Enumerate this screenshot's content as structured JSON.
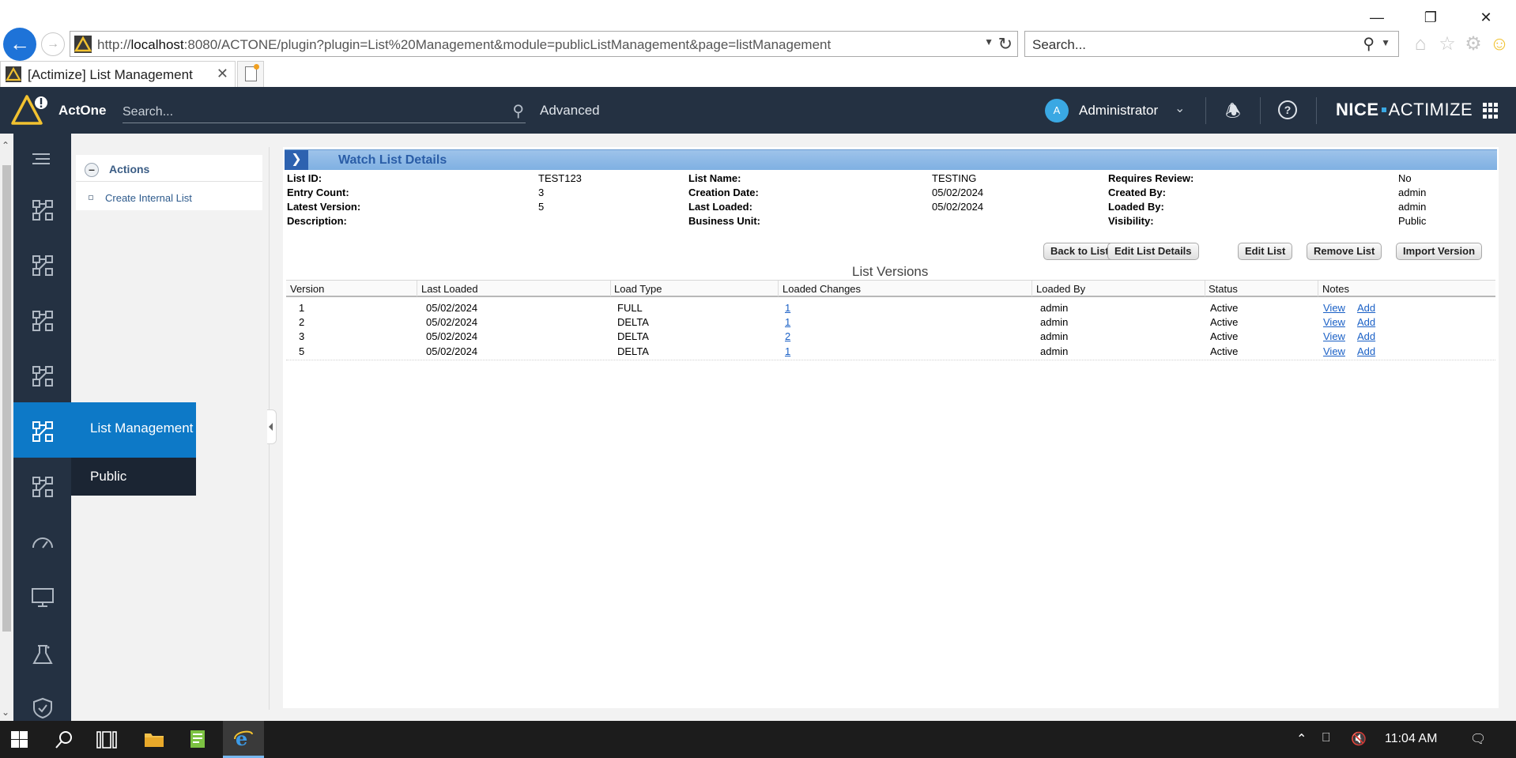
{
  "browser": {
    "url_prefix": "http://",
    "url_host": "localhost",
    "url_rest": ":8080/ACTONE/plugin?plugin=List%20Management&module=publicListManagement&page=listManagement",
    "search_placeholder": "Search...",
    "tab_title": "[Actimize] List Management"
  },
  "header": {
    "app_name": "ActOne",
    "search_placeholder": "Search...",
    "advanced_label": "Advanced",
    "avatar_initial": "A",
    "user_name": "Administrator",
    "brand_left": "NICE",
    "brand_right": "ACTIMIZE"
  },
  "flyout": {
    "active_label": "List Management",
    "sub_label": "Public"
  },
  "actions": {
    "title": "Actions",
    "create_label": "Create Internal List"
  },
  "details": {
    "section_title": "Watch List Details",
    "list_id_label": "List ID:",
    "list_id": "TEST123",
    "entry_count_label": "Entry Count:",
    "entry_count": "3",
    "latest_version_label": "Latest Version:",
    "latest_version": "5",
    "description_label": "Description:",
    "list_name_label": "List Name:",
    "list_name": "TESTING",
    "creation_date_label": "Creation Date:",
    "creation_date": "05/02/2024",
    "last_loaded_label": "Last Loaded:",
    "last_loaded": "05/02/2024",
    "business_unit_label": "Business Unit:",
    "requires_review_label": "Requires Review:",
    "requires_review": "No",
    "created_by_label": "Created By:",
    "created_by": "admin",
    "loaded_by_label": "Loaded By:",
    "loaded_by": "admin",
    "visibility_label": "Visibility:",
    "visibility": "Public"
  },
  "buttons": {
    "back": "Back to Lists",
    "edit_details": "Edit List Details",
    "edit_list": "Edit List",
    "remove": "Remove List",
    "import": "Import Version"
  },
  "versions": {
    "title": "List Versions",
    "columns": [
      "Version",
      "Last Loaded",
      "Load Type",
      "Loaded Changes",
      "Loaded By",
      "Status",
      "Notes"
    ],
    "rows": [
      {
        "version": "1",
        "last_loaded": "05/02/2024",
        "load_type": "FULL",
        "changes": "1",
        "loaded_by": "admin",
        "status": "Active",
        "view": "View",
        "add": "Add"
      },
      {
        "version": "2",
        "last_loaded": "05/02/2024",
        "load_type": "DELTA",
        "changes": "1",
        "loaded_by": "admin",
        "status": "Active",
        "view": "View",
        "add": "Add"
      },
      {
        "version": "3",
        "last_loaded": "05/02/2024",
        "load_type": "DELTA",
        "changes": "2",
        "loaded_by": "admin",
        "status": "Active",
        "view": "View",
        "add": "Add"
      },
      {
        "version": "5",
        "last_loaded": "05/02/2024",
        "load_type": "DELTA",
        "changes": "1",
        "loaded_by": "admin",
        "status": "Active",
        "view": "View",
        "add": "Add"
      }
    ]
  },
  "taskbar": {
    "time": "11:04 AM"
  },
  "colors": {
    "header_bg": "#243142",
    "accent_blue": "#0d79c7",
    "section_header": "#7fb0e2",
    "link": "#1a60c6"
  }
}
